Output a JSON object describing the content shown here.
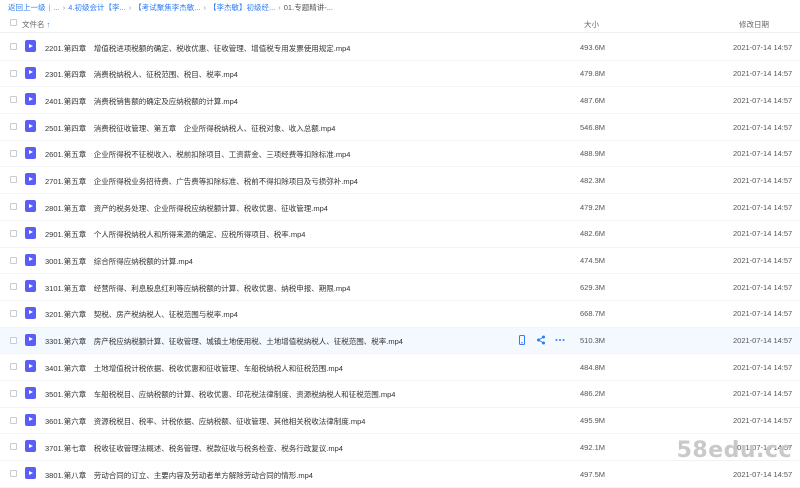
{
  "breadcrumb": {
    "items": [
      "返回上一级",
      "...",
      "4.初级会计【李...",
      "【考试聚焦李杰敏...",
      "【李杰敏】初级经...",
      "01.专题精讲-..."
    ]
  },
  "header": {
    "name_label": "文件名",
    "sort_indicator": "↑",
    "size_label": "大小",
    "date_label": "修改日期"
  },
  "files": [
    {
      "name": "2201.第四章　增值税进项税额的确定、税收优惠、征收管理、增值税专用发票使用规定.mp4",
      "size": "493.6M",
      "date": "2021-07-14 14:57"
    },
    {
      "name": "2301.第四章　消费税纳税人、征税范围、税目、税率.mp4",
      "size": "479.8M",
      "date": "2021-07-14 14:57"
    },
    {
      "name": "2401.第四章　消费税销售额的确定及应纳税额的计算.mp4",
      "size": "487.6M",
      "date": "2021-07-14 14:57"
    },
    {
      "name": "2501.第四章　消费税征收管理、第五章　企业所得税纳税人、征税对象、收入总额.mp4",
      "size": "546.8M",
      "date": "2021-07-14 14:57"
    },
    {
      "name": "2601.第五章　企业所得税不征税收入、税前扣除项目、工资薪金、三项经费等扣除标准.mp4",
      "size": "488.9M",
      "date": "2021-07-14 14:57"
    },
    {
      "name": "2701.第五章　企业所得税业务招待费、广告费等扣除标准、税前不得扣除项目及亏损弥补.mp4",
      "size": "482.3M",
      "date": "2021-07-14 14:57"
    },
    {
      "name": "2801.第五章　资产的税务处理、企业所得税应纳税额计算、税收优惠、征收管理.mp4",
      "size": "479.2M",
      "date": "2021-07-14 14:57"
    },
    {
      "name": "2901.第五章　个人所得税纳税人和所得来源的确定、应税所得项目、税率.mp4",
      "size": "482.6M",
      "date": "2021-07-14 14:57"
    },
    {
      "name": "3001.第五章　综合所得应纳税额的计算.mp4",
      "size": "474.5M",
      "date": "2021-07-14 14:57"
    },
    {
      "name": "3101.第五章　经营所得、利息股息红利等应纳税额的计算、税收优惠、纳税申报、期限.mp4",
      "size": "629.3M",
      "date": "2021-07-14 14:57"
    },
    {
      "name": "3201.第六章　契税、房产税纳税人、征税范围与税率.mp4",
      "size": "668.7M",
      "date": "2021-07-14 14:57"
    },
    {
      "name": "3301.第六章　房产税应纳税额计算、征收管理、城镇土地使用税、土地增值税纳税人、征税范围、税率.mp4",
      "size": "510.3M",
      "date": "2021-07-14 14:57"
    },
    {
      "name": "3401.第六章　土地增值税计税依据、税收优惠和征收管理、车船税纳税人和征税范围.mp4",
      "size": "484.8M",
      "date": "2021-07-14 14:57"
    },
    {
      "name": "3501.第六章　车船税税目、应纳税额的计算、税收优惠、印花税法律制度、资源税纳税人和征税范围.mp4",
      "size": "486.2M",
      "date": "2021-07-14 14:57"
    },
    {
      "name": "3601.第六章　资源税税目、税率、计税依据、应纳税额、征收管理、其他相关税收法律制度.mp4",
      "size": "495.9M",
      "date": "2021-07-14 14:57"
    },
    {
      "name": "3701.第七章　税收征收管理法概述、税务管理、税款征收与税务检查、税务行政复议.mp4",
      "size": "492.1M",
      "date": "2021-07-14 14:57"
    },
    {
      "name": "3801.第八章　劳动合同的订立、主要内容及劳动者单方解除劳动合同的情形.mp4",
      "size": "497.5M",
      "date": "2021-07-14 14:57"
    }
  ],
  "hover_row_index": 11,
  "watermark": "58edu.cc",
  "colors": {
    "accent": "#2e7cf6",
    "file_icon": "#5b5ef6"
  }
}
